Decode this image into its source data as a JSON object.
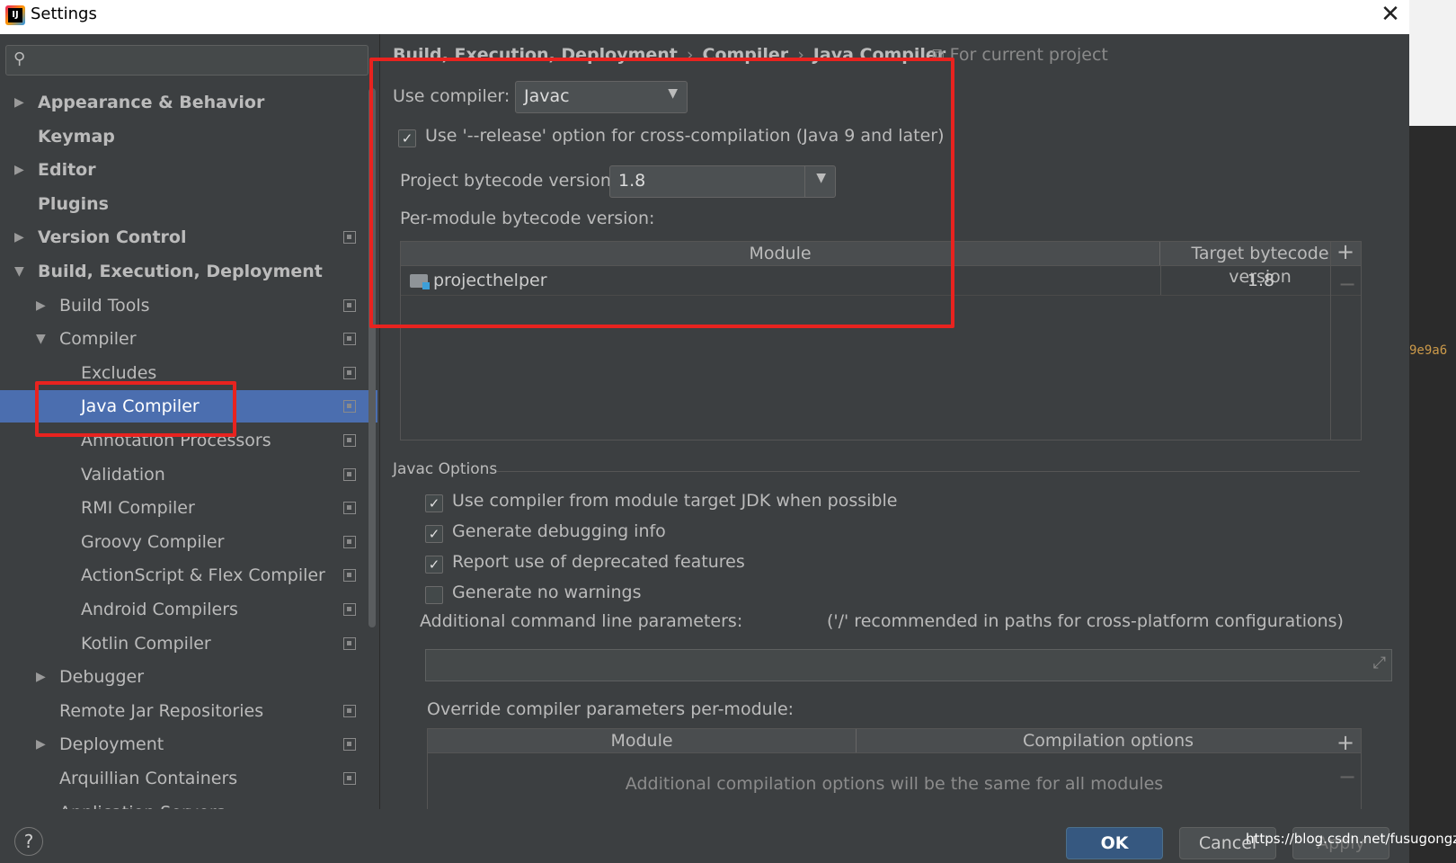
{
  "window": {
    "title": "Settings",
    "close": "✕"
  },
  "search": {
    "placeholder": ""
  },
  "sidebar": {
    "items": [
      {
        "label": "Appearance & Behavior",
        "level": 0,
        "bold": true,
        "arrow": "right",
        "project": false
      },
      {
        "label": "Keymap",
        "level": 0,
        "bold": true,
        "arrow": "",
        "project": false
      },
      {
        "label": "Editor",
        "level": 0,
        "bold": true,
        "arrow": "right",
        "project": false
      },
      {
        "label": "Plugins",
        "level": 0,
        "bold": true,
        "arrow": "",
        "project": false
      },
      {
        "label": "Version Control",
        "level": 0,
        "bold": true,
        "arrow": "right",
        "project": true
      },
      {
        "label": "Build, Execution, Deployment",
        "level": 0,
        "bold": true,
        "arrow": "down",
        "project": false
      },
      {
        "label": "Build Tools",
        "level": 1,
        "bold": false,
        "arrow": "right",
        "project": true
      },
      {
        "label": "Compiler",
        "level": 1,
        "bold": false,
        "arrow": "down",
        "project": true
      },
      {
        "label": "Excludes",
        "level": 2,
        "bold": false,
        "arrow": "",
        "project": true
      },
      {
        "label": "Java Compiler",
        "level": 2,
        "bold": false,
        "arrow": "",
        "project": true,
        "selected": true
      },
      {
        "label": "Annotation Processors",
        "level": 2,
        "bold": false,
        "arrow": "",
        "project": true
      },
      {
        "label": "Validation",
        "level": 2,
        "bold": false,
        "arrow": "",
        "project": true
      },
      {
        "label": "RMI Compiler",
        "level": 2,
        "bold": false,
        "arrow": "",
        "project": true
      },
      {
        "label": "Groovy Compiler",
        "level": 2,
        "bold": false,
        "arrow": "",
        "project": true
      },
      {
        "label": "ActionScript & Flex Compiler",
        "level": 2,
        "bold": false,
        "arrow": "",
        "project": true
      },
      {
        "label": "Android Compilers",
        "level": 2,
        "bold": false,
        "arrow": "",
        "project": true
      },
      {
        "label": "Kotlin Compiler",
        "level": 2,
        "bold": false,
        "arrow": "",
        "project": true
      },
      {
        "label": "Debugger",
        "level": 1,
        "bold": false,
        "arrow": "right",
        "project": false
      },
      {
        "label": "Remote Jar Repositories",
        "level": 1,
        "bold": false,
        "arrow": "",
        "project": true
      },
      {
        "label": "Deployment",
        "level": 1,
        "bold": false,
        "arrow": "right",
        "project": true
      },
      {
        "label": "Arquillian Containers",
        "level": 1,
        "bold": false,
        "arrow": "",
        "project": true
      },
      {
        "label": "Application Servers",
        "level": 1,
        "bold": false,
        "arrow": "",
        "project": false
      }
    ]
  },
  "breadcrumb": [
    "Build, Execution, Deployment",
    "Compiler",
    "Java Compiler"
  ],
  "breadcrumb_sep": "›",
  "scope_label": "For current project",
  "compiler": {
    "use_compiler_label": "Use compiler:",
    "use_compiler_value": "Javac",
    "release_option_label": "Use '--release' option for cross-compilation (Java 9 and later)",
    "release_option_checked": true,
    "bytecode_label": "Project bytecode version:",
    "bytecode_value": "1.8",
    "per_module_label": "Per-module bytecode version:",
    "module_table": {
      "columns": [
        "Module",
        "Target bytecode version"
      ],
      "rows": [
        {
          "module": "projecthelper",
          "version": "1.8"
        }
      ]
    }
  },
  "javac_options": {
    "section_title": "Javac Options",
    "checkboxes": [
      {
        "label": "Use compiler from module target JDK when possible",
        "checked": true
      },
      {
        "label": "Generate debugging info",
        "checked": true
      },
      {
        "label": "Report use of deprecated features",
        "checked": true
      },
      {
        "label": "Generate no warnings",
        "checked": false
      }
    ],
    "additional_params_label": "Additional command line parameters:",
    "additional_params_hint": "('/' recommended in paths for cross-platform configurations)",
    "additional_params_value": "",
    "override_label": "Override compiler parameters per-module:",
    "override_table": {
      "columns": [
        "Module",
        "Compilation options"
      ],
      "empty_text": "Additional compilation options will be the same for all modules"
    }
  },
  "footer": {
    "help": "?",
    "ok": "OK",
    "cancel": "Cancel",
    "apply": "Apply"
  },
  "watermark": "https://blog.csdn.net/fusugongzi",
  "background_text": {
    "hash": "9e9a6"
  },
  "icons": {
    "add": "+",
    "remove": "−",
    "expand": "⤢"
  },
  "colors": {
    "selection": "#4b6eaf",
    "ok_button": "#365880",
    "annotation": "#e8231f"
  }
}
